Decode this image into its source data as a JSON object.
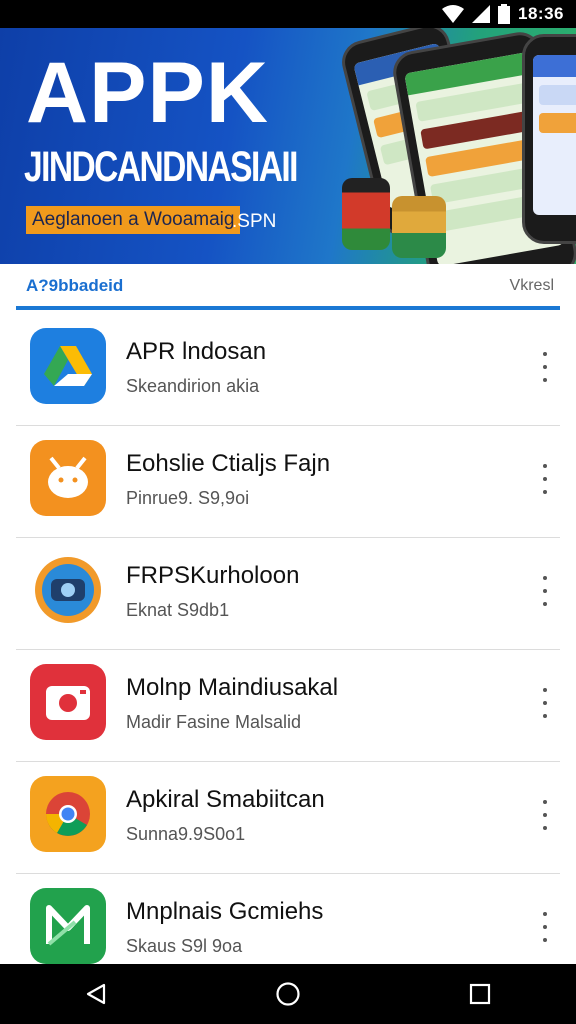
{
  "status_bar": {
    "time": "18:36",
    "icons": [
      "wifi-icon",
      "signal-icon",
      "battery-icon"
    ]
  },
  "banner": {
    "title": "APPK",
    "subtitle": "JINDCANDNASIAII",
    "tagline": "Aeglanoen a Wooamaig",
    "tagline_tail": ".SPN"
  },
  "tabs": {
    "left": "A?9bbadeid",
    "right": "Vkresl"
  },
  "apps": [
    {
      "name": "APR lndosan",
      "subtitle": "Skeandirion akia",
      "icon": "drive-icon",
      "color": "#1e7fe0"
    },
    {
      "name": "Eohslie Ctialjs Fajn",
      "subtitle": "Pinrue9. S9,9oi",
      "icon": "android-face-icon",
      "color": "#f3911f"
    },
    {
      "name": "FRPSKurholoon",
      "subtitle": "Eknat S9db1",
      "icon": "gear-camera-icon",
      "color": "#2a8ad8"
    },
    {
      "name": "Molnp Maindiusakal",
      "subtitle": "Madir Fasine Malsalid",
      "icon": "camera-icon",
      "color": "#e0313b"
    },
    {
      "name": "Apkiral Smabiitcan",
      "subtitle": "Sunna9.9S0o1",
      "icon": "chrome-icon",
      "color": "#f4a21f"
    },
    {
      "name": "Mnplnais Gcmiehs",
      "subtitle": "Skaus S9l 9oa",
      "icon": "m-logo-icon",
      "color": "#22a24d"
    }
  ],
  "nav": [
    "back-icon",
    "home-icon",
    "recents-icon"
  ]
}
